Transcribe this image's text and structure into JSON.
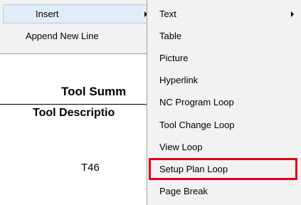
{
  "document": {
    "title": "Tool Summ",
    "column_header": "Tool Descriptio",
    "row_value": "T46"
  },
  "context_menu": {
    "items": [
      {
        "label": "Insert",
        "has_submenu": true,
        "highlighted": true
      },
      {
        "label": "Append New Line",
        "has_submenu": false
      }
    ]
  },
  "insert_submenu": {
    "items": [
      {
        "label": "Text",
        "has_submenu": true
      },
      {
        "label": "Table"
      },
      {
        "label": "Picture"
      },
      {
        "label": "Hyperlink"
      },
      {
        "label": "NC Program Loop"
      },
      {
        "label": "Tool Change Loop"
      },
      {
        "label": "View Loop"
      },
      {
        "label": "Setup Plan Loop",
        "selected": true
      },
      {
        "label": "Page Break"
      }
    ],
    "selection_outline_color": "#e0001a"
  },
  "icons": {
    "submenu_arrow": "chevron-right-icon"
  }
}
